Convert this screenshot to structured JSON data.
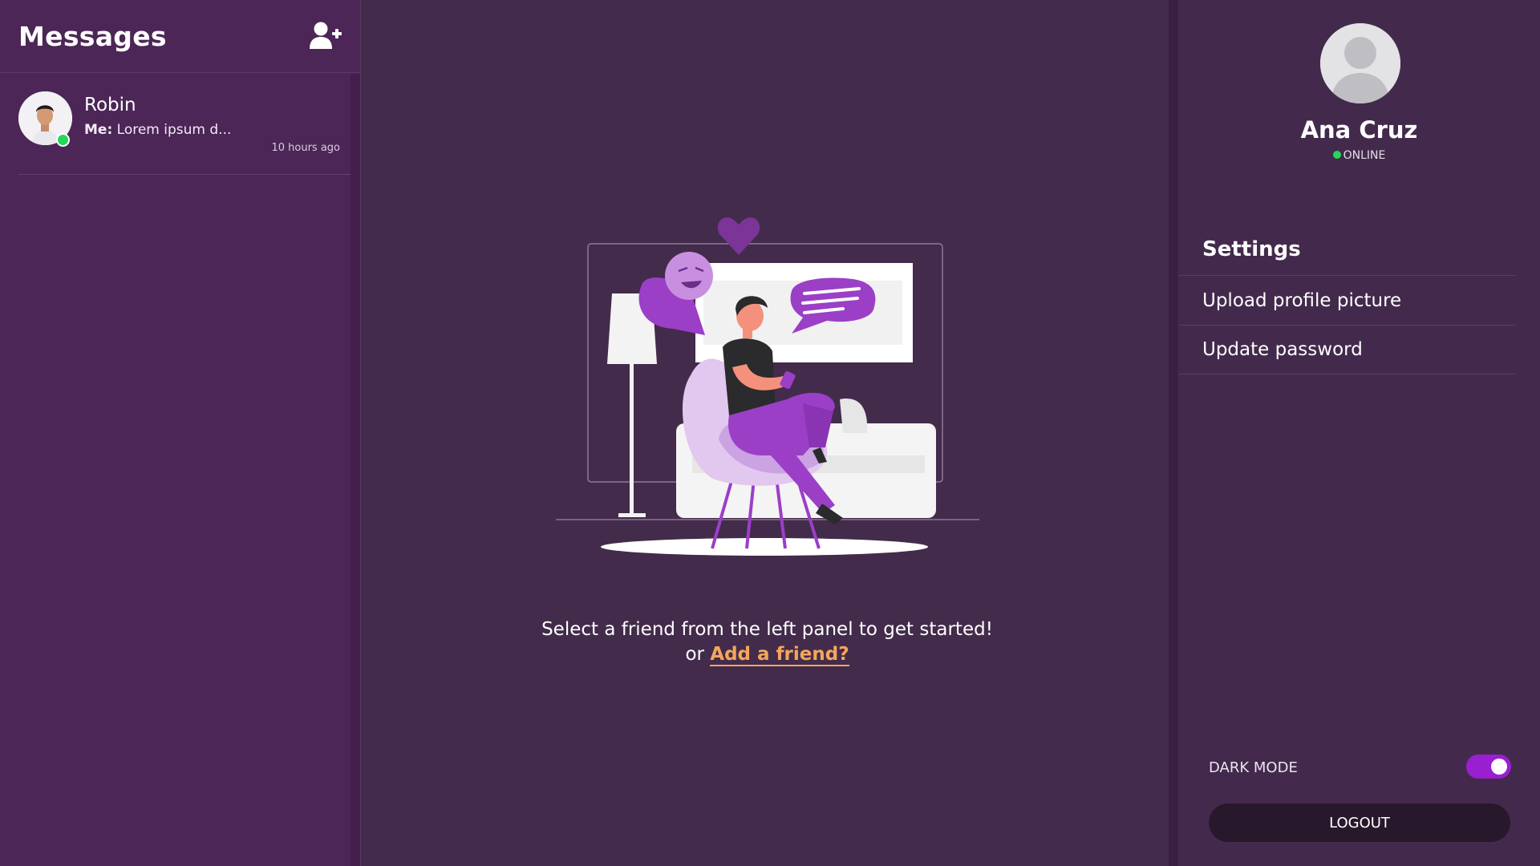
{
  "sidebar": {
    "title": "Messages",
    "add_friend_icon": "user-plus-icon",
    "conversations": [
      {
        "name": "Robin",
        "preview_sender": "Me:",
        "preview_text": "Lorem ipsum d...",
        "time": "10 hours ago",
        "online": true
      }
    ]
  },
  "main": {
    "prompt_line_1": "Select a friend from the left panel to get started!",
    "prompt_or": "or",
    "add_friend_link": "Add a friend?"
  },
  "profile": {
    "name": "Ana Cruz",
    "status": "ONLINE"
  },
  "settings": {
    "title": "Settings",
    "items": [
      "Upload profile picture",
      "Update password"
    ]
  },
  "footer": {
    "dark_mode_label": "DARK MODE",
    "dark_mode_on": true,
    "logout_label": "LOGOUT"
  },
  "colors": {
    "panel_bg": "#4c2656",
    "main_bg": "#432b4b",
    "accent_link": "#f4a65a",
    "toggle_on": "#9a1fd1",
    "online": "#23d85a"
  }
}
